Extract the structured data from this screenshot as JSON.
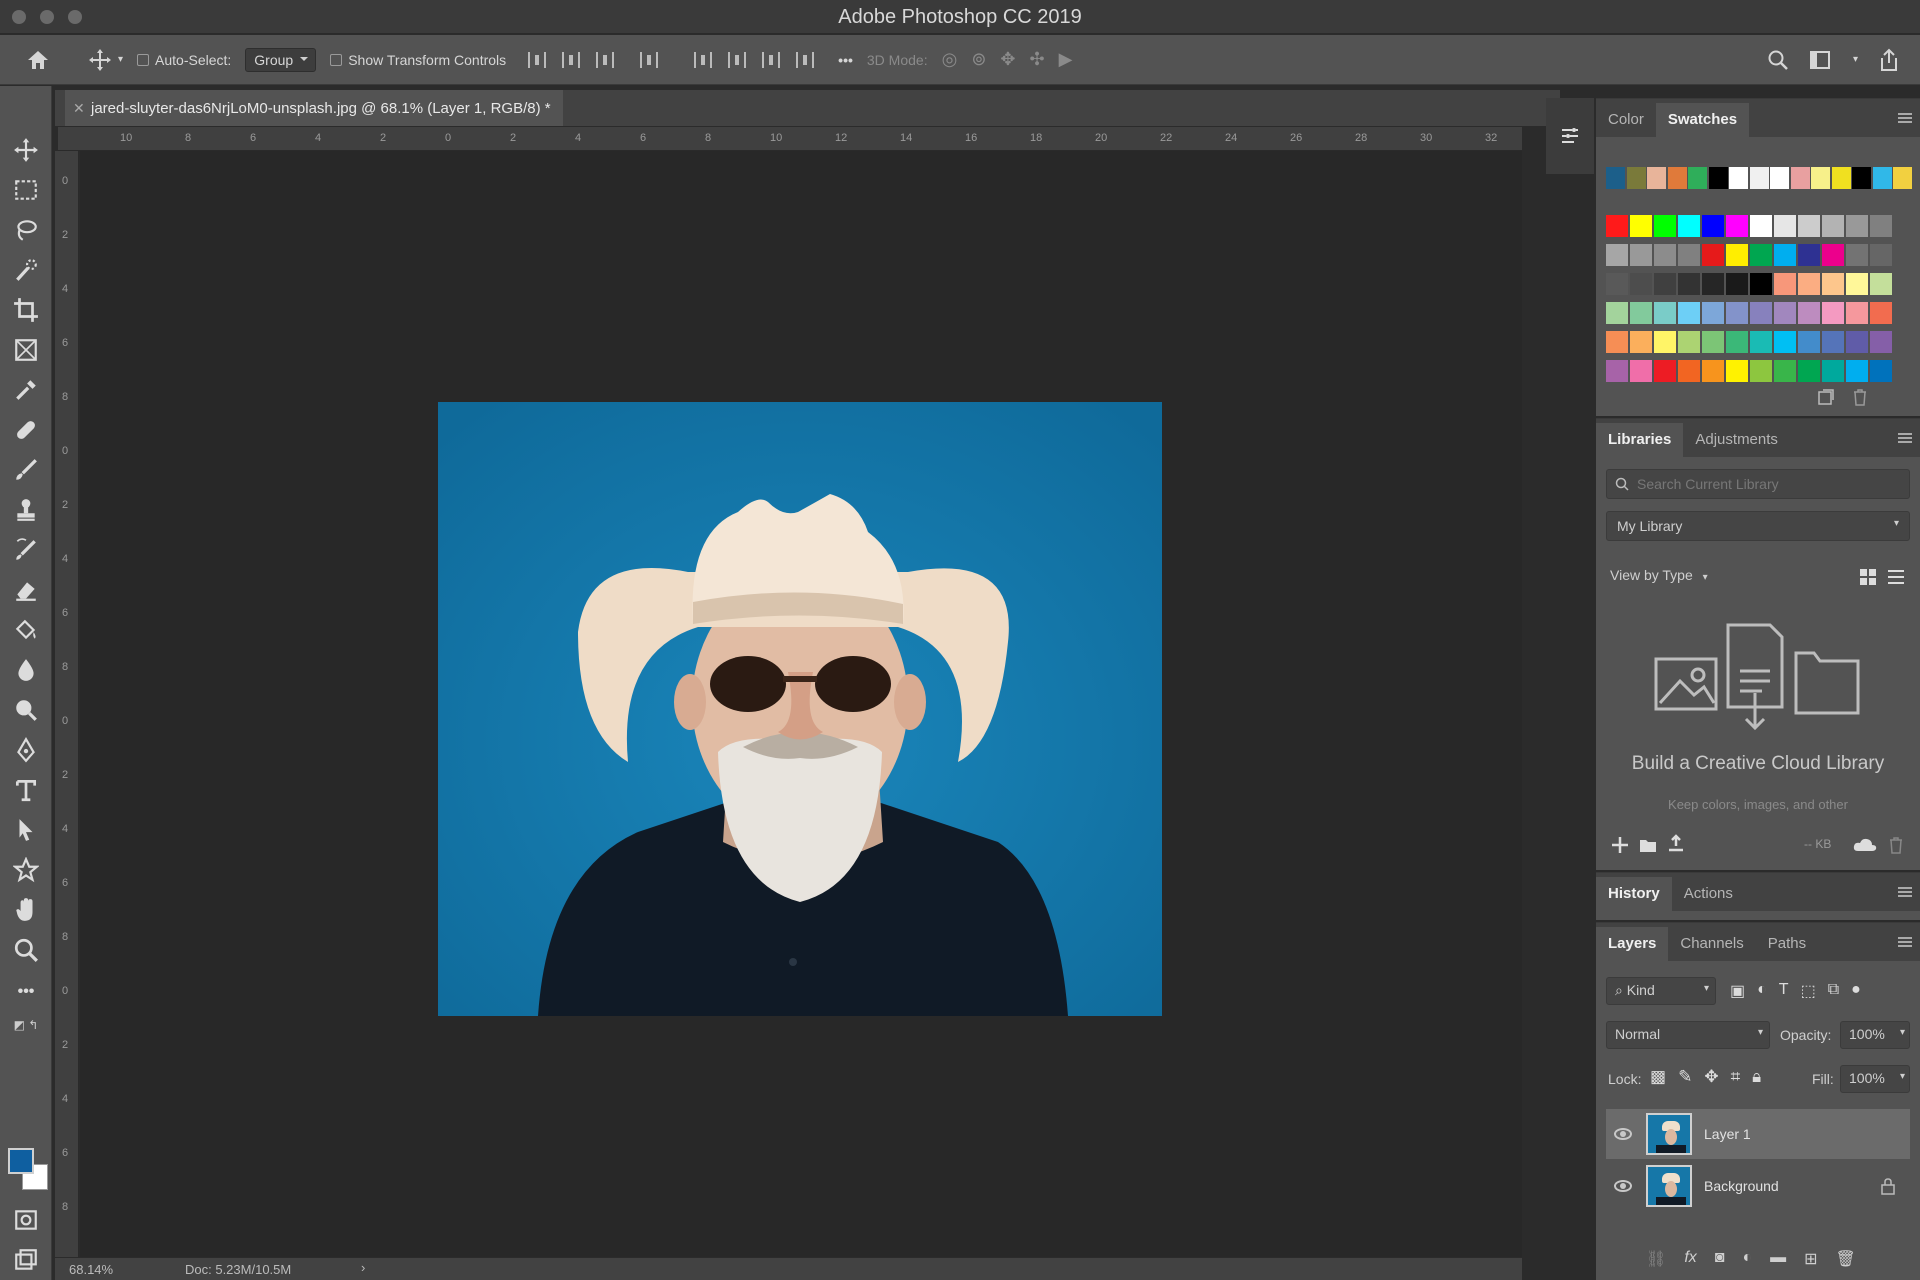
{
  "window": {
    "title": "Adobe Photoshop CC 2019"
  },
  "options_bar": {
    "auto_select_label": "Auto-Select:",
    "auto_select_value": "Group",
    "show_transform_label": "Show Transform Controls",
    "more_label": "•••",
    "mode_3d_label": "3D Mode:"
  },
  "document": {
    "tab_title": "jared-sluyter-das6NrjLoM0-unsplash.jpg @ 68.1% (Layer 1, RGB/8) *"
  },
  "rulers": {
    "horizontal": [
      "10",
      "8",
      "6",
      "4",
      "2",
      "0",
      "2",
      "4",
      "6",
      "8",
      "10",
      "12",
      "14",
      "16",
      "18",
      "20",
      "22",
      "24",
      "26",
      "28",
      "30",
      "32"
    ],
    "vertical": [
      "0",
      "2",
      "4",
      "6",
      "8",
      "0",
      "2",
      "4",
      "6",
      "8",
      "0",
      "2",
      "4",
      "6",
      "8",
      "0",
      "2",
      "4",
      "6",
      "8"
    ]
  },
  "status": {
    "zoom": "68.14%",
    "doc": "Doc: 5.23M/10.5M"
  },
  "swatches_panel": {
    "tabs": [
      "Color",
      "Swatches"
    ],
    "active_tab": "Swatches",
    "recent_colors": [
      "#1c5f8a",
      "#7a7a3a",
      "#e8b49a",
      "#e07a3a",
      "#2fae5a",
      "#000000",
      "#ffffff",
      "#f0f0f0",
      "#ffffff",
      "#e8a0a0",
      "#f7f08a",
      "#f0e020",
      "#000000",
      "#30b8e8",
      "#f2d040"
    ],
    "grid_colors": [
      [
        "#ff1a1a",
        "#ffff00",
        "#00ff00",
        "#00ffff",
        "#0000ff",
        "#ff00ff",
        "#ffffff",
        "#e6e6e6",
        "#cccccc",
        "#b3b3b3",
        "#999999",
        "#808080"
      ],
      [
        "#a6a6a6",
        "#999999",
        "#8c8c8c",
        "#808080",
        "#e61a1a",
        "#ffee00",
        "#00a650",
        "#00aeef",
        "#2e3192",
        "#ec008c",
        "#737373",
        "#666666"
      ],
      [
        "#595959",
        "#4d4d4d",
        "#404040",
        "#333333",
        "#262626",
        "#1a1a1a",
        "#000000",
        "#f7977a",
        "#fbad82",
        "#fdc68c",
        "#fff799",
        "#c4df9b"
      ],
      [
        "#a3d39c",
        "#82ca9c",
        "#7accc8",
        "#6dcff6",
        "#7da7d9",
        "#8393ca",
        "#8781bd",
        "#a187be",
        "#bd8cbf",
        "#f49ac1",
        "#f5989d",
        "#f26c4f"
      ],
      [
        "#f68e55",
        "#fbaf5c",
        "#fff467",
        "#acd372",
        "#7cc576",
        "#3bb878",
        "#1abbb4",
        "#00bff3",
        "#438ccb",
        "#5574b9",
        "#605ca8",
        "#855fa8"
      ],
      [
        "#a763a8",
        "#f06ea9",
        "#ed1c24",
        "#f26522",
        "#f7941d",
        "#fff200",
        "#8dc63f",
        "#39b54a",
        "#00a651",
        "#00a99d",
        "#00aeef",
        "#0072bc"
      ]
    ]
  },
  "libraries_panel": {
    "tabs": [
      "Libraries",
      "Adjustments"
    ],
    "active_tab": "Libraries",
    "search_placeholder": "Search Current Library",
    "library_select": "My Library",
    "view_by": "View by Type",
    "empty_title": "Build a Creative Cloud Library",
    "empty_sub": "Keep colors, images, and other",
    "size_label": "-- KB"
  },
  "history_panel": {
    "tabs": [
      "History",
      "Actions"
    ],
    "active_tab": "History"
  },
  "layers_panel": {
    "tabs": [
      "Layers",
      "Channels",
      "Paths"
    ],
    "active_tab": "Layers",
    "filter_kind": "Kind",
    "blend_mode": "Normal",
    "opacity_label": "Opacity:",
    "opacity_value": "100%",
    "lock_label": "Lock:",
    "fill_label": "Fill:",
    "fill_value": "100%",
    "layers": [
      {
        "name": "Layer 1",
        "selected": true
      },
      {
        "name": "Background",
        "selected": false,
        "locked": true
      }
    ]
  },
  "colors": {
    "app_dark": "#282828",
    "panel": "#535353",
    "photo_bg": "#1677a8",
    "foreground": "#0f5fa0",
    "background": "#ffffff"
  }
}
